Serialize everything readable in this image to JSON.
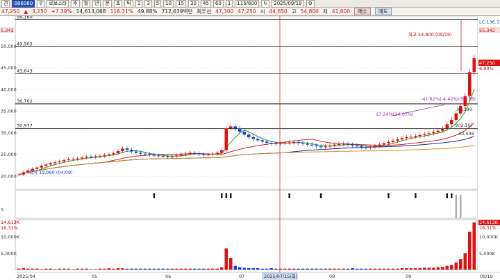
{
  "toolbar": {
    "view_label": "견",
    "code": "086080",
    "name": "로보스타",
    "periods": [
      "주",
      "월",
      "년",
      "분",
      "초",
      "틱"
    ],
    "intervals": [
      "1",
      "3",
      "5",
      "10",
      "15",
      "30",
      "45",
      "60",
      "1"
    ],
    "count": "115/600",
    "date": "2025/09/19"
  },
  "info": {
    "price": "47,250",
    "change": "3,250",
    "change_pct": "+7.39%",
    "volume": "14,613,068",
    "vol_ratio": "116.31%",
    "turnover": "49.88%",
    "amount": "712,639백만",
    "pref_label": "최우선",
    "bid": "47,300",
    "ask": "47,250",
    "open_label": "시",
    "open": "44,650",
    "high_label": "고",
    "high": "54,800",
    "low_label": "저",
    "low": "41,600",
    "buy_label": "매수",
    "sell_label": "매도"
  },
  "price_panel": {
    "hlines": [
      {
        "value": 56160,
        "label": "56,160"
      },
      {
        "value": 49903,
        "label": "49,903"
      },
      {
        "value": 43643,
        "label": "43,643"
      },
      {
        "value": 36702,
        "label": "36,702"
      },
      {
        "value": 30977,
        "label": "30,977"
      }
    ],
    "y_ticks": [
      "50,000",
      "45,000",
      "40,000",
      "35,000",
      "30,000",
      "25,000",
      "20,000"
    ],
    "y_values": [
      50000,
      45000,
      40000,
      35000,
      30000,
      25000,
      20000
    ],
    "top_left_label": "5,343",
    "right_top_label": "LC:136.37",
    "right_second_label": "55,343",
    "current_price_label": "47,250",
    "current_pct_label": "6.90%",
    "high_annotation": "최고 54,800 (09/19)",
    "low_annotation": "최저 19,990 (04/09)",
    "fib_annotation": "-41.82%(-4.42%)(56.78)",
    "pct_annotation": "17.24%(10.07%)",
    "annotation_36399": "36,399",
    "annotation_30536": "30,536",
    "annotation_902": "902.10)"
  },
  "signal_panel": {
    "y_label": "5"
  },
  "volume_panel": {
    "top_label": "14,613K",
    "pct_label": "16.31%",
    "y_ticks": [
      "10,000K",
      "5,000K"
    ]
  },
  "x_axis": {
    "labels": [
      "2025/04",
      "05",
      "06",
      "07",
      "08",
      "09",
      "09/19"
    ],
    "crosshair_date": "2025/07/15(화)"
  },
  "chart_data": {
    "type": "candlestick",
    "ylim": [
      17000,
      57000
    ],
    "series_price": [
      20400,
      20900,
      21300,
      21700,
      22000,
      22400,
      22700,
      23000,
      23200,
      23400,
      23700,
      23900,
      24000,
      24100,
      24300,
      24500,
      24400,
      24600,
      24700,
      24900,
      25100,
      25300,
      25800,
      26400,
      26100,
      25700,
      25400,
      25200,
      25100,
      24900,
      24800,
      24700,
      24600,
      24500,
      24600,
      24800,
      25000,
      25200,
      25400,
      25300,
      25100,
      24900,
      25000,
      25200,
      25400,
      26000,
      31000,
      31500,
      31000,
      30300,
      29600,
      29000,
      28600,
      28300,
      28000,
      27700,
      27600,
      27500,
      27600,
      27700,
      27800,
      27900,
      27700,
      27500,
      27300,
      27100,
      26900,
      26700,
      26900,
      27100,
      27300,
      27400,
      27500,
      27300,
      27100,
      26900,
      26700,
      26600,
      26800,
      27000,
      27300,
      27600,
      27900,
      28200,
      28500,
      28800,
      29000,
      29100,
      29300,
      29500,
      29700,
      29900,
      30200,
      30500,
      31000,
      32000,
      33000,
      34500,
      36200,
      38500,
      44000,
      47250
    ],
    "volume_bars": [
      0.02,
      0.03,
      0.02,
      0.02,
      0.02,
      0.01,
      0.02,
      0.02,
      0.01,
      0.02,
      0.02,
      0.02,
      0.01,
      0.02,
      0.02,
      0.02,
      0.01,
      0.01,
      0.02,
      0.02,
      0.03,
      0.02,
      0.03,
      0.03,
      0.02,
      0.02,
      0.02,
      0.02,
      0.02,
      0.02,
      0.02,
      0.02,
      0.02,
      0.02,
      0.02,
      0.02,
      0.02,
      0.02,
      0.02,
      0.02,
      0.02,
      0.02,
      0.02,
      0.02,
      0.02,
      0.05,
      0.45,
      0.25,
      0.08,
      0.05,
      0.04,
      0.03,
      0.03,
      0.03,
      0.02,
      0.02,
      0.03,
      0.02,
      0.02,
      0.02,
      0.02,
      0.02,
      0.02,
      0.02,
      0.02,
      0.02,
      0.02,
      0.02,
      0.02,
      0.02,
      0.02,
      0.02,
      0.02,
      0.02,
      0.03,
      0.02,
      0.02,
      0.02,
      0.02,
      0.02,
      0.02,
      0.02,
      0.02,
      0.02,
      0.02,
      0.03,
      0.03,
      0.03,
      0.03,
      0.03,
      0.04,
      0.04,
      0.04,
      0.05,
      0.06,
      0.08,
      0.1,
      0.15,
      0.22,
      0.35,
      0.8,
      1.0
    ],
    "signals": [
      30,
      45,
      46,
      47,
      60,
      67,
      82,
      88,
      95,
      96,
      97,
      98
    ]
  }
}
